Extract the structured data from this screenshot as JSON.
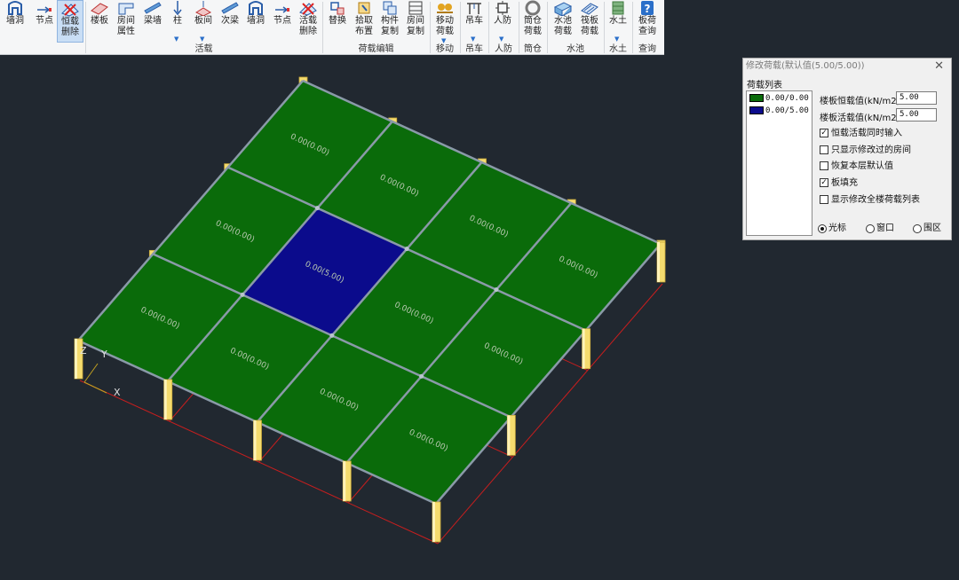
{
  "ribbon": {
    "buttons": [
      {
        "id": "wall-hole",
        "label": "墙洞",
        "icon": "wall-hole-icon"
      },
      {
        "id": "node",
        "label": "节点",
        "icon": "node-icon"
      },
      {
        "id": "dead-load-delete",
        "label": "恒载\n删除",
        "icon": "delete-load-icon",
        "active": true
      },
      {
        "id": "slab",
        "label": "楼板",
        "icon": "slab-icon"
      },
      {
        "id": "room-attr",
        "label": "房间\n属性",
        "icon": "room-attr-icon"
      },
      {
        "id": "beam-wall",
        "label": "梁墙",
        "icon": "beam-icon"
      },
      {
        "id": "column",
        "label": "柱",
        "icon": "column-icon",
        "dropdown": true
      },
      {
        "id": "slab-span",
        "label": "板间",
        "icon": "slab-span-icon",
        "dropdown": true
      },
      {
        "id": "secondary-beam",
        "label": "次梁",
        "icon": "secondary-beam-icon"
      },
      {
        "id": "wall-hole-2",
        "label": "墙洞",
        "icon": "wall-hole-icon"
      },
      {
        "id": "node-2",
        "label": "节点",
        "icon": "node-icon"
      },
      {
        "id": "live-load-delete",
        "label": "活载\n删除",
        "icon": "delete-load-icon"
      },
      {
        "id": "replace",
        "label": "替换",
        "icon": "replace-icon"
      },
      {
        "id": "pick-layout",
        "label": "拾取\n布置",
        "icon": "pick-icon"
      },
      {
        "id": "member-copy",
        "label": "构件\n复制",
        "icon": "copy-icon"
      },
      {
        "id": "room-copy",
        "label": "房间\n复制",
        "icon": "room-copy-icon"
      },
      {
        "id": "move-load",
        "label": "移动\n荷载",
        "icon": "move-load-icon",
        "dropdown": true
      },
      {
        "id": "crane",
        "label": "吊车",
        "icon": "crane-icon",
        "dropdown": true
      },
      {
        "id": "civil-defense",
        "label": "人防",
        "icon": "civil-defense-icon",
        "dropdown": true
      },
      {
        "id": "silo-load",
        "label": "筒仓\n荷载",
        "icon": "silo-icon"
      },
      {
        "id": "pool-load",
        "label": "水池\n荷载",
        "icon": "pool-icon"
      },
      {
        "id": "bottom-slab-load",
        "label": "筏板\n荷载",
        "icon": "raft-icon"
      },
      {
        "id": "water-soil",
        "label": "水土",
        "icon": "water-soil-icon",
        "dropdown": true
      },
      {
        "id": "slab-load-query",
        "label": "板荷\n查询",
        "icon": "help-icon"
      }
    ],
    "groups": [
      {
        "label": "活载"
      },
      {
        "label": "荷载编辑"
      },
      {
        "label": "移动"
      },
      {
        "label": "吊车"
      },
      {
        "label": "人防"
      },
      {
        "label": "筒仓"
      },
      {
        "label": "水池"
      },
      {
        "label": "水土"
      },
      {
        "label": "查询"
      }
    ]
  },
  "viewport": {
    "axis": {
      "z": "Z",
      "y": "Y",
      "x": "X"
    },
    "panels": [
      {
        "row": 0,
        "col": 0,
        "label": "0.00(0.00)",
        "selected": false
      },
      {
        "row": 0,
        "col": 1,
        "label": "0.00(0.00)",
        "selected": false
      },
      {
        "row": 0,
        "col": 2,
        "label": "0.00(0.00)",
        "selected": false
      },
      {
        "row": 0,
        "col": 3,
        "label": "0.00(0.00)",
        "selected": false
      },
      {
        "row": 1,
        "col": 0,
        "label": "0.00(0.00)",
        "selected": false
      },
      {
        "row": 1,
        "col": 1,
        "label": "0.00(5.00)",
        "selected": true
      },
      {
        "row": 1,
        "col": 2,
        "label": "0.00(0.00)",
        "selected": false
      },
      {
        "row": 1,
        "col": 3,
        "label": "0.00(0.00)",
        "selected": false
      },
      {
        "row": 2,
        "col": 0,
        "label": "0.00(0.00)",
        "selected": false
      },
      {
        "row": 2,
        "col": 1,
        "label": "0.00(0.00)",
        "selected": false
      },
      {
        "row": 2,
        "col": 2,
        "label": "0.00(0.00)",
        "selected": false
      },
      {
        "row": 2,
        "col": 3,
        "label": "0.00(0.00)",
        "selected": false
      }
    ],
    "colors": {
      "background": "#212830",
      "slab": "#0a6b0a",
      "selected": "#0b0b8c",
      "beam": "#8a9aa8",
      "column": "#f5dc6e",
      "grid_line": "#c81e1e"
    }
  },
  "dialog": {
    "title": "修改荷载(默认值(5.00/5.00))",
    "close": "✕",
    "list_label": "荷载列表",
    "list": [
      {
        "text": "0.00/0.00",
        "color": "#0a6b0a"
      },
      {
        "text": "0.00/5.00",
        "color": "#0b0b8c"
      }
    ],
    "dead_label": "楼板恒载值(kN/m2)",
    "dead_value": "5.00",
    "live_label": "楼板活载值(kN/m2)",
    "live_value": "5.00",
    "options": [
      {
        "label": "恒载活载同时输入",
        "checked": true
      },
      {
        "label": "只显示修改过的房间",
        "checked": false
      },
      {
        "label": "恢复本层默认值",
        "checked": false
      },
      {
        "label": "板填充",
        "checked": true
      },
      {
        "label": "显示修改全楼荷载列表",
        "checked": false
      }
    ],
    "radios": [
      {
        "label": "光标",
        "selected": true
      },
      {
        "label": "窗口",
        "selected": false
      },
      {
        "label": "围区",
        "selected": false
      }
    ]
  }
}
